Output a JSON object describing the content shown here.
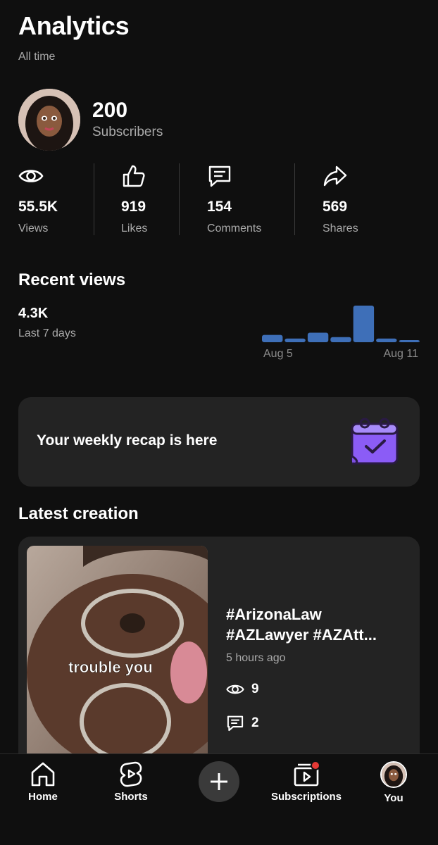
{
  "header": {
    "title": "Analytics",
    "range": "All time"
  },
  "profile": {
    "subscriber_count": "200",
    "subscriber_label": "Subscribers"
  },
  "stats": [
    {
      "icon": "eye-icon",
      "value": "55.5K",
      "label": "Views"
    },
    {
      "icon": "thumbs-up-icon",
      "value": "919",
      "label": "Likes"
    },
    {
      "icon": "comment-icon",
      "value": "154",
      "label": "Comments"
    },
    {
      "icon": "share-icon",
      "value": "569",
      "label": "Shares"
    }
  ],
  "recent_views": {
    "title": "Recent views",
    "value": "4.3K",
    "period": "Last 7 days",
    "axis_start": "Aug 5",
    "axis_end": "Aug 11"
  },
  "chart_data": {
    "type": "bar",
    "categories": [
      "Aug 5",
      "Aug 6",
      "Aug 7",
      "Aug 8",
      "Aug 9",
      "Aug 10",
      "Aug 11"
    ],
    "values": [
      0.2,
      0.1,
      0.26,
      0.14,
      1.0,
      0.1,
      0.04
    ],
    "color": "#3e6fb8"
  },
  "recap": {
    "text": "Your weekly recap is here",
    "icon": "calendar-check-icon",
    "icon_color": "#8b5cf6"
  },
  "latest": {
    "title": "Latest creation",
    "thumbnail_caption": "trouble you",
    "video_title": "#ArizonaLaw\n#AZLawyer #AZAtt...",
    "time": "5 hours ago",
    "views": "9",
    "comments": "2"
  },
  "nav": {
    "home": "Home",
    "shorts": "Shorts",
    "subscriptions": "Subscriptions",
    "you": "You",
    "notification_color": "#e53935"
  }
}
